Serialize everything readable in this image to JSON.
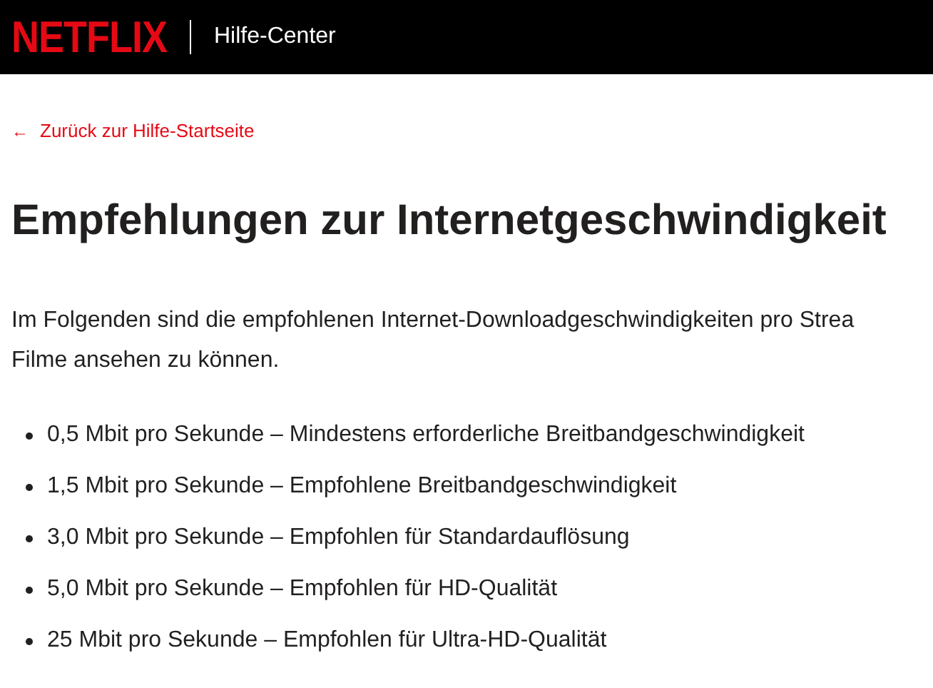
{
  "header": {
    "logo": "NETFLIX",
    "title": "Hilfe-Center"
  },
  "back_link": {
    "icon": "←",
    "label": "Zurück zur Hilfe-Startseite"
  },
  "heading": "Empfehlungen zur Internetgeschwindigkeit",
  "intro": "Im Folgenden sind die empfohlenen Internet-Downloadgeschwindigkeiten pro Strea\nFilme ansehen zu können.",
  "items": [
    "0,5 Mbit pro Sekunde – Mindestens erforderliche Breitbandgeschwindigkeit",
    "1,5 Mbit pro Sekunde – Empfohlene Breitbandgeschwindigkeit",
    "3,0 Mbit pro Sekunde – Empfohlen für Standardauflösung",
    "5,0 Mbit pro Sekunde – Empfohlen für HD-Qualität",
    "25 Mbit pro Sekunde – Empfohlen für Ultra-HD-Qualität"
  ]
}
